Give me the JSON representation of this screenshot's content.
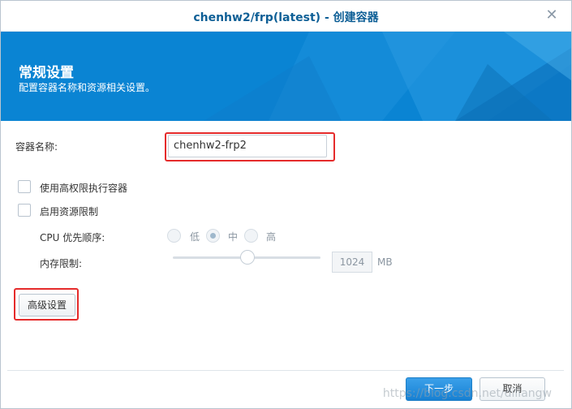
{
  "window": {
    "title": "chenhw2/frp(latest) - 创建容器",
    "close_glyph": "✕"
  },
  "banner": {
    "title": "常规设置",
    "subtitle": "配置容器名称和资源相关设置。",
    "color": "#0a84d3"
  },
  "form": {
    "container_name_label": "容器名称:",
    "container_name_value": "chenhw2-frp2",
    "privileged_label": "使用高权限执行容器",
    "privileged_checked": false,
    "resource_limit_label": "启用资源限制",
    "resource_limit_checked": false,
    "cpu_priority_label": "CPU 优先顺序:",
    "cpu_options": [
      "低",
      "中",
      "高"
    ],
    "cpu_selected": "中",
    "memory_label": "内存限制:",
    "memory_value": "1024",
    "memory_unit": "MB",
    "advanced_button": "高级设置"
  },
  "footer": {
    "next_button": "下一步",
    "cancel_button": "取消",
    "watermark": "https://blog.csdn.net/diliangw"
  },
  "colors": {
    "accent": "#0a84d3",
    "highlight_box": "#e52b2b"
  }
}
